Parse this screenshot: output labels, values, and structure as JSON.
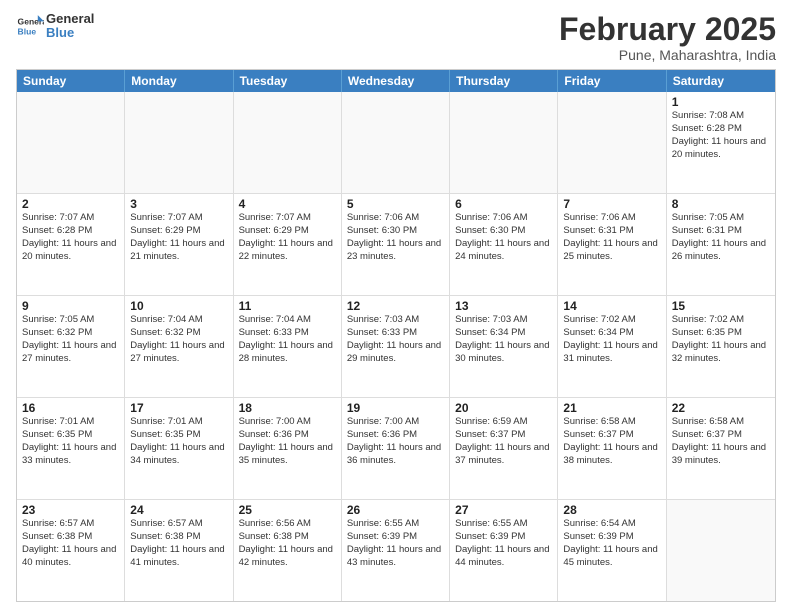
{
  "logo": {
    "text_general": "General",
    "text_blue": "Blue"
  },
  "title": "February 2025",
  "subtitle": "Pune, Maharashtra, India",
  "days": [
    "Sunday",
    "Monday",
    "Tuesday",
    "Wednesday",
    "Thursday",
    "Friday",
    "Saturday"
  ],
  "weeks": [
    [
      {
        "day": "",
        "empty": true
      },
      {
        "day": "",
        "empty": true
      },
      {
        "day": "",
        "empty": true
      },
      {
        "day": "",
        "empty": true
      },
      {
        "day": "",
        "empty": true
      },
      {
        "day": "",
        "empty": true
      },
      {
        "day": "1",
        "info": "Sunrise: 7:08 AM\nSunset: 6:28 PM\nDaylight: 11 hours and 20 minutes."
      }
    ],
    [
      {
        "day": "2",
        "info": "Sunrise: 7:07 AM\nSunset: 6:28 PM\nDaylight: 11 hours and 20 minutes."
      },
      {
        "day": "3",
        "info": "Sunrise: 7:07 AM\nSunset: 6:29 PM\nDaylight: 11 hours and 21 minutes."
      },
      {
        "day": "4",
        "info": "Sunrise: 7:07 AM\nSunset: 6:29 PM\nDaylight: 11 hours and 22 minutes."
      },
      {
        "day": "5",
        "info": "Sunrise: 7:06 AM\nSunset: 6:30 PM\nDaylight: 11 hours and 23 minutes."
      },
      {
        "day": "6",
        "info": "Sunrise: 7:06 AM\nSunset: 6:30 PM\nDaylight: 11 hours and 24 minutes."
      },
      {
        "day": "7",
        "info": "Sunrise: 7:06 AM\nSunset: 6:31 PM\nDaylight: 11 hours and 25 minutes."
      },
      {
        "day": "8",
        "info": "Sunrise: 7:05 AM\nSunset: 6:31 PM\nDaylight: 11 hours and 26 minutes."
      }
    ],
    [
      {
        "day": "9",
        "info": "Sunrise: 7:05 AM\nSunset: 6:32 PM\nDaylight: 11 hours and 27 minutes."
      },
      {
        "day": "10",
        "info": "Sunrise: 7:04 AM\nSunset: 6:32 PM\nDaylight: 11 hours and 27 minutes."
      },
      {
        "day": "11",
        "info": "Sunrise: 7:04 AM\nSunset: 6:33 PM\nDaylight: 11 hours and 28 minutes."
      },
      {
        "day": "12",
        "info": "Sunrise: 7:03 AM\nSunset: 6:33 PM\nDaylight: 11 hours and 29 minutes."
      },
      {
        "day": "13",
        "info": "Sunrise: 7:03 AM\nSunset: 6:34 PM\nDaylight: 11 hours and 30 minutes."
      },
      {
        "day": "14",
        "info": "Sunrise: 7:02 AM\nSunset: 6:34 PM\nDaylight: 11 hours and 31 minutes."
      },
      {
        "day": "15",
        "info": "Sunrise: 7:02 AM\nSunset: 6:35 PM\nDaylight: 11 hours and 32 minutes."
      }
    ],
    [
      {
        "day": "16",
        "info": "Sunrise: 7:01 AM\nSunset: 6:35 PM\nDaylight: 11 hours and 33 minutes."
      },
      {
        "day": "17",
        "info": "Sunrise: 7:01 AM\nSunset: 6:35 PM\nDaylight: 11 hours and 34 minutes."
      },
      {
        "day": "18",
        "info": "Sunrise: 7:00 AM\nSunset: 6:36 PM\nDaylight: 11 hours and 35 minutes."
      },
      {
        "day": "19",
        "info": "Sunrise: 7:00 AM\nSunset: 6:36 PM\nDaylight: 11 hours and 36 minutes."
      },
      {
        "day": "20",
        "info": "Sunrise: 6:59 AM\nSunset: 6:37 PM\nDaylight: 11 hours and 37 minutes."
      },
      {
        "day": "21",
        "info": "Sunrise: 6:58 AM\nSunset: 6:37 PM\nDaylight: 11 hours and 38 minutes."
      },
      {
        "day": "22",
        "info": "Sunrise: 6:58 AM\nSunset: 6:37 PM\nDaylight: 11 hours and 39 minutes."
      }
    ],
    [
      {
        "day": "23",
        "info": "Sunrise: 6:57 AM\nSunset: 6:38 PM\nDaylight: 11 hours and 40 minutes."
      },
      {
        "day": "24",
        "info": "Sunrise: 6:57 AM\nSunset: 6:38 PM\nDaylight: 11 hours and 41 minutes."
      },
      {
        "day": "25",
        "info": "Sunrise: 6:56 AM\nSunset: 6:38 PM\nDaylight: 11 hours and 42 minutes."
      },
      {
        "day": "26",
        "info": "Sunrise: 6:55 AM\nSunset: 6:39 PM\nDaylight: 11 hours and 43 minutes."
      },
      {
        "day": "27",
        "info": "Sunrise: 6:55 AM\nSunset: 6:39 PM\nDaylight: 11 hours and 44 minutes."
      },
      {
        "day": "28",
        "info": "Sunrise: 6:54 AM\nSunset: 6:39 PM\nDaylight: 11 hours and 45 minutes."
      },
      {
        "day": "",
        "empty": true
      }
    ]
  ]
}
